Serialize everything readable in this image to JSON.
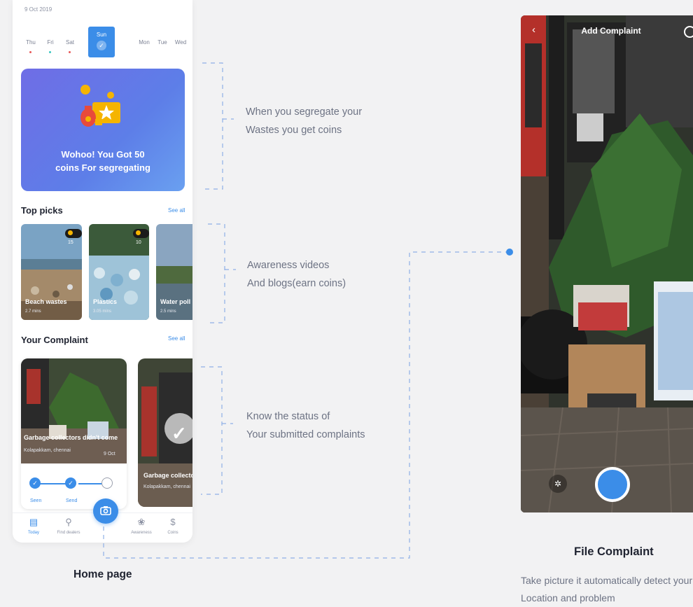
{
  "home": {
    "date": "9 Oct 2019",
    "week": [
      {
        "label": "Thu",
        "dot": "#e85a5a"
      },
      {
        "label": "Fri",
        "dot": "#3cc6c0"
      },
      {
        "label": "Sat",
        "dot": "#e85a5a"
      },
      {
        "label": "Sun",
        "selected": true
      },
      {
        "label": "Mon"
      },
      {
        "label": "Tue"
      },
      {
        "label": "Wed"
      }
    ],
    "banner": {
      "text": "Wohoo! You Got 50\ncoins For segregating"
    },
    "top_picks": {
      "title": "Top picks",
      "see_all": "See all",
      "items": [
        {
          "title": "Beach wastes",
          "meta": "2.7 mins",
          "coins": "15"
        },
        {
          "title": "Plastics",
          "meta": "3.05 mins",
          "coins": "10"
        },
        {
          "title": "Water poll",
          "meta": "2.5 mins"
        }
      ]
    },
    "your_complaint": {
      "title": "Your Complaint",
      "see_all": "See all",
      "card": {
        "title": "Garbage collectors didn't come",
        "location": "Kolapakkam, chennai",
        "date": "9 Oct",
        "steps": [
          "Seen",
          "Send"
        ]
      },
      "card2": {
        "title": "Garbage collector",
        "location": "Kolapakkam, chennai"
      }
    },
    "nav": [
      {
        "label": "Today",
        "icon": "calendar-icon",
        "glyph": "▤",
        "active": true
      },
      {
        "label": "Find dealers",
        "icon": "dealers-icon",
        "glyph": "⚲"
      },
      {
        "label": "Awareness",
        "icon": "lotus-icon",
        "glyph": "❀"
      },
      {
        "label": "Coins",
        "icon": "dollar-icon",
        "glyph": "$"
      }
    ],
    "fab_icon": "camera-icon"
  },
  "annotations": {
    "coins": "When you segregate your\nWastes you get coins",
    "awareness": "Awareness videos\nAnd blogs(earn coins)",
    "status": "Know the status of\nYour submitted complaints",
    "home_caption": "Home page"
  },
  "camera": {
    "title": "Add Complaint",
    "caption_title": "File Complaint",
    "caption_desc": "Take picture it automatically detect your\nLocation and problem"
  },
  "colors": {
    "accent": "#3b8de8",
    "banner_start": "#6f6de6",
    "banner_end": "#6aa0f0"
  }
}
